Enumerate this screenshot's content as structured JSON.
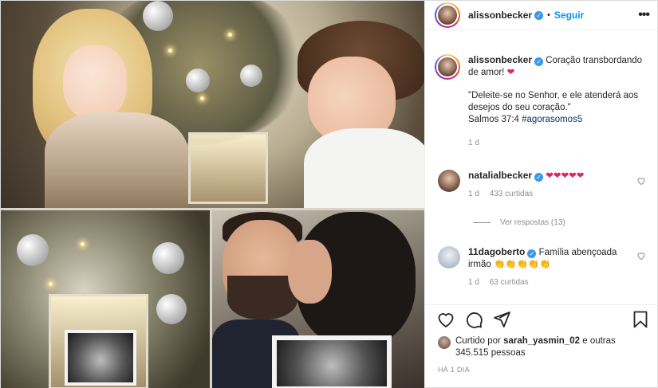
{
  "post": {
    "author": "alissonbecker",
    "follow_label": "Seguir",
    "more_label": "•••",
    "separator": "•"
  },
  "caption": {
    "author": "alissonbecker",
    "text": "Coração transbordando de amor!",
    "emoji": "❤",
    "quote": "\"Deleite-se no Senhor, e ele atenderá aos desejos do seu coração.\"",
    "verse": "Salmos 37:4",
    "hashtag": "#agorasomos5",
    "time": "1 d"
  },
  "comments": [
    {
      "author": "natalialbecker",
      "text": "❤❤❤❤❤",
      "time": "1 d",
      "likes": "433 curtidas",
      "view_replies": "Ver respostas (13)"
    },
    {
      "author": "11dagoberto",
      "text": "Família abençoada irmão 👏👏👏👏👏",
      "time": "1 d",
      "likes": "63 curtidas"
    }
  ],
  "icons": {
    "like": "heart-icon",
    "comment": "comment-icon",
    "share": "share-icon",
    "save": "bookmark-icon",
    "verified": "verified-badge-icon",
    "more": "more-options-icon"
  },
  "likes": {
    "prefix": "Curtido por",
    "user": "sarah_yasmin_02",
    "connector": "e",
    "others": "outras 345.515 pessoas"
  },
  "posted_ago": "HÁ 1 DIA",
  "colors": {
    "link_blue": "#0095f6",
    "verified_blue": "#3897f0",
    "heart_red": "#e0245e",
    "meta_gray": "#8e8e8e",
    "text": "#262626"
  }
}
